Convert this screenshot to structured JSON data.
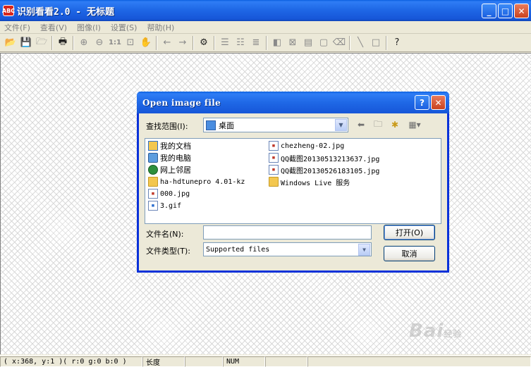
{
  "window": {
    "title": "识别看看2.0 - 无标题",
    "icon_text": "ABC"
  },
  "menu": [
    "文件(F)",
    "查看(V)",
    "图像(I)",
    "设置(S)",
    "帮助(H)"
  ],
  "toolbar": {
    "zoom_1to1": "1:1"
  },
  "dialog": {
    "title": "Open image file",
    "look_in_label": "查找范围(I):",
    "look_in_value": "桌面",
    "files_col1": [
      "我的文档",
      "我的电脑",
      "网上邻居",
      "ha-hdtunepro 4.01-kz",
      "000.jpg",
      "3.gif"
    ],
    "files_col2": [
      "chezheng-02.jpg",
      "QQ截图20130513213637.jpg",
      "QQ截图20130526183105.jpg",
      "Windows Live 服务"
    ],
    "filename_label": "文件名(N):",
    "filename_value": "",
    "filetype_label": "文件类型(T):",
    "filetype_value": "Supported files",
    "open_button": "打开(O)",
    "cancel_button": "取消"
  },
  "status": {
    "coords": "( x:368, y:1 )( r:0 g:0 b:0 )",
    "length_label": "长度",
    "num": "NUM"
  },
  "watermark": {
    "text": "Bai",
    "suffix": "经验"
  }
}
